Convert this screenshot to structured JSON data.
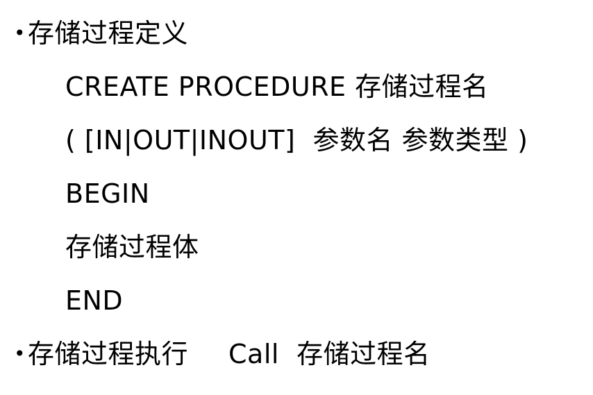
{
  "slide": {
    "bullet_symbol": "•",
    "item1_heading": "存储过程定义",
    "syntax": {
      "line1": "CREATE PROCEDURE 存储过程名",
      "line2": "( [IN|OUT|INOUT]  参数名 参数类型 )",
      "line3": "BEGIN",
      "line4": "存储过程体",
      "line5": "END"
    },
    "item2_heading": "存储过程执行",
    "item2_call": "Call  存储过程名"
  }
}
